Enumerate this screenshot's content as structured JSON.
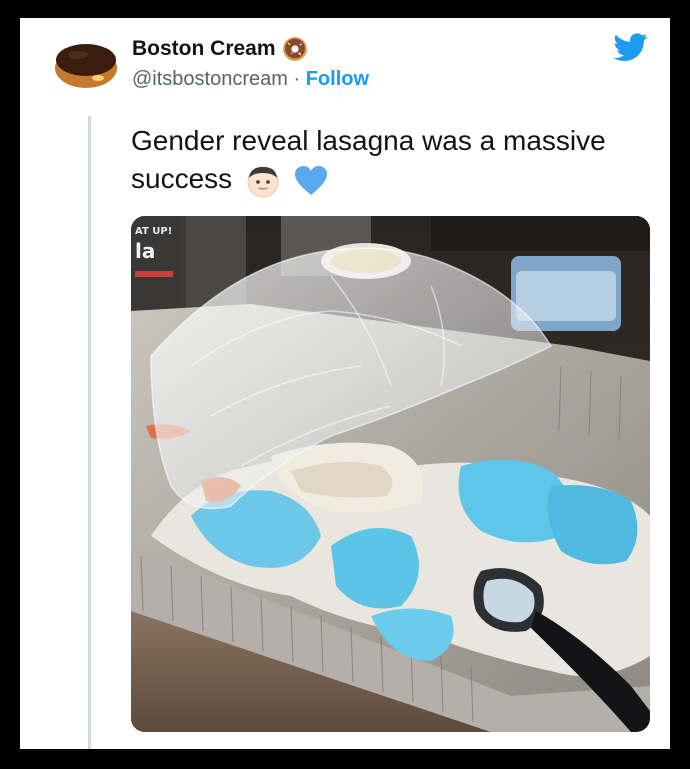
{
  "tweet": {
    "display_name": "Boston Cream",
    "display_name_emoji": "donut-icon",
    "handle": "@itsbostoncream",
    "separator": "·",
    "follow_label": "Follow",
    "text": "Gender reveal lasagna was a massive success",
    "text_emojis": [
      "boy-face-icon",
      "blue-heart-icon"
    ],
    "media": {
      "description_icon": "photo-lasagna-icon",
      "box_label_top": "AT UP!",
      "box_label_mid": "la"
    },
    "logo": "twitter-bird-icon",
    "colors": {
      "accent": "#1d9bf0",
      "text": "#0f1419",
      "secondary": "#536471",
      "blue_frosting": "#5cc4e6"
    }
  }
}
